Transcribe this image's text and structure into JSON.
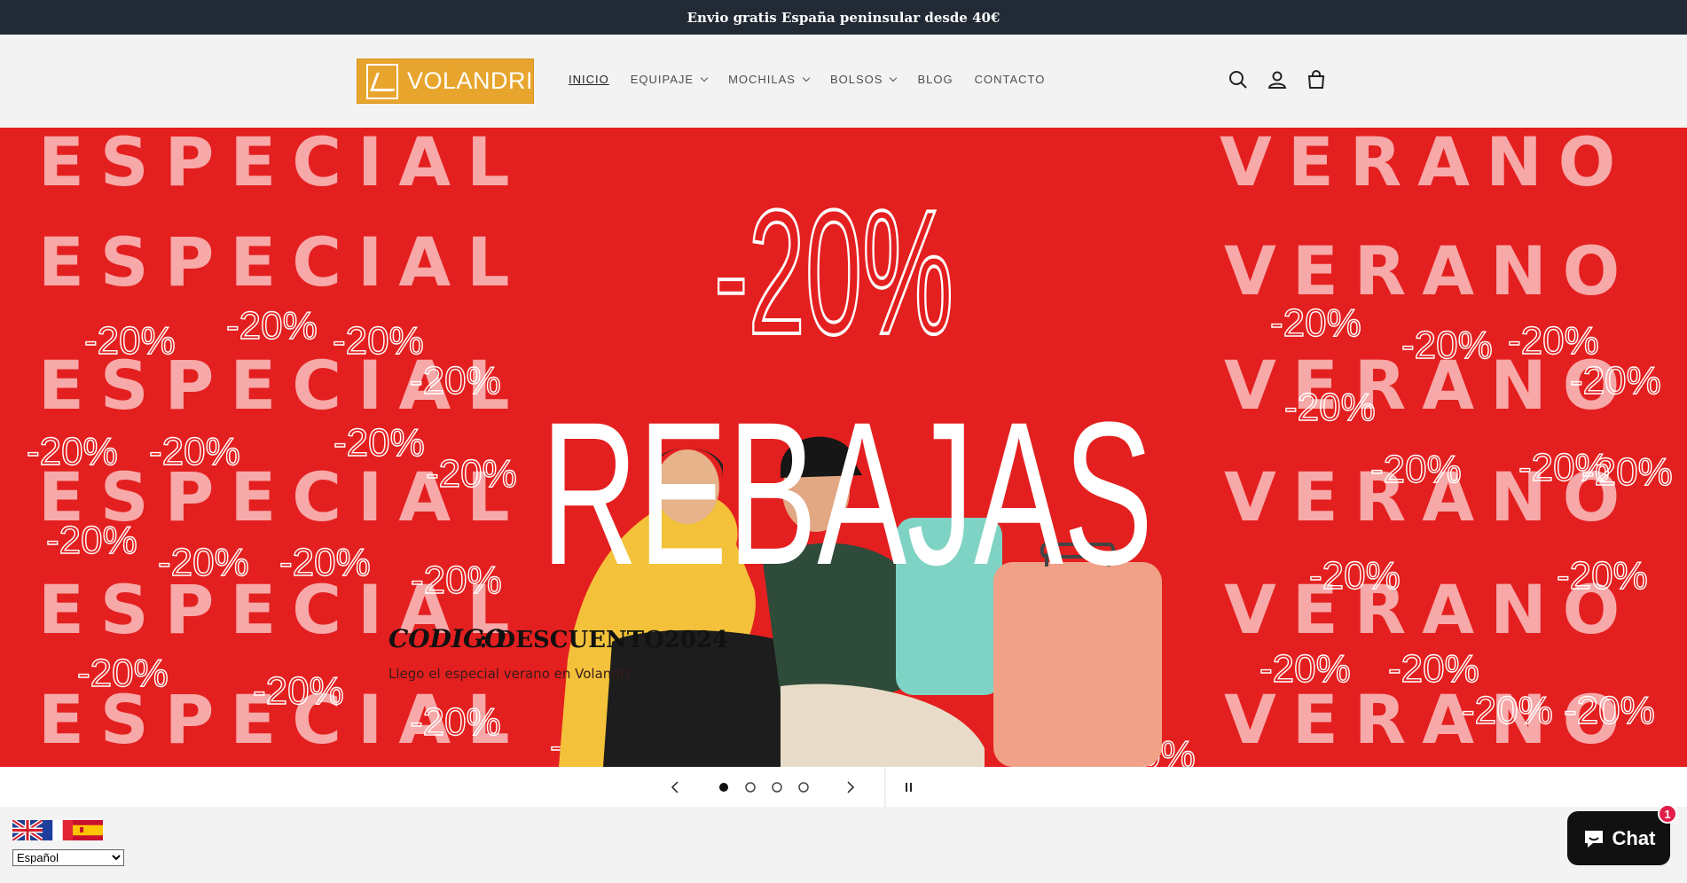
{
  "announcement": "Envio gratis España peninsular desde 40€",
  "logo": {
    "text": "VOLANDRI"
  },
  "nav": [
    {
      "label": "INICIO",
      "dropdown": false,
      "active": true
    },
    {
      "label": "EQUIPAJE",
      "dropdown": true
    },
    {
      "label": "MOCHILAS",
      "dropdown": true
    },
    {
      "label": "BOLSOS",
      "dropdown": true
    },
    {
      "label": "BLOG",
      "dropdown": false
    },
    {
      "label": "CONTACTO",
      "dropdown": false
    }
  ],
  "header_icons": [
    "search-icon",
    "account-icon",
    "cart-icon"
  ],
  "hero": {
    "left_word": "ESPECIAL",
    "right_word": "VERANO",
    "percent": "-20%",
    "headline": "REBAJAS",
    "code_label": "CODIGO",
    "code_value": ": DESCUENTO2024",
    "subtitle": "Llego el especial verano en Volandri",
    "colors": {
      "background": "#e41f1f",
      "pale_text": "#f7a8a8"
    }
  },
  "slider": {
    "slide_count": 4,
    "active_index": 0
  },
  "language": {
    "flags": [
      "uk-flag-icon",
      "france-flag-icon",
      "spain-flag-icon"
    ],
    "selected": "Español"
  },
  "chat": {
    "label": "Chat",
    "badge": "1"
  }
}
